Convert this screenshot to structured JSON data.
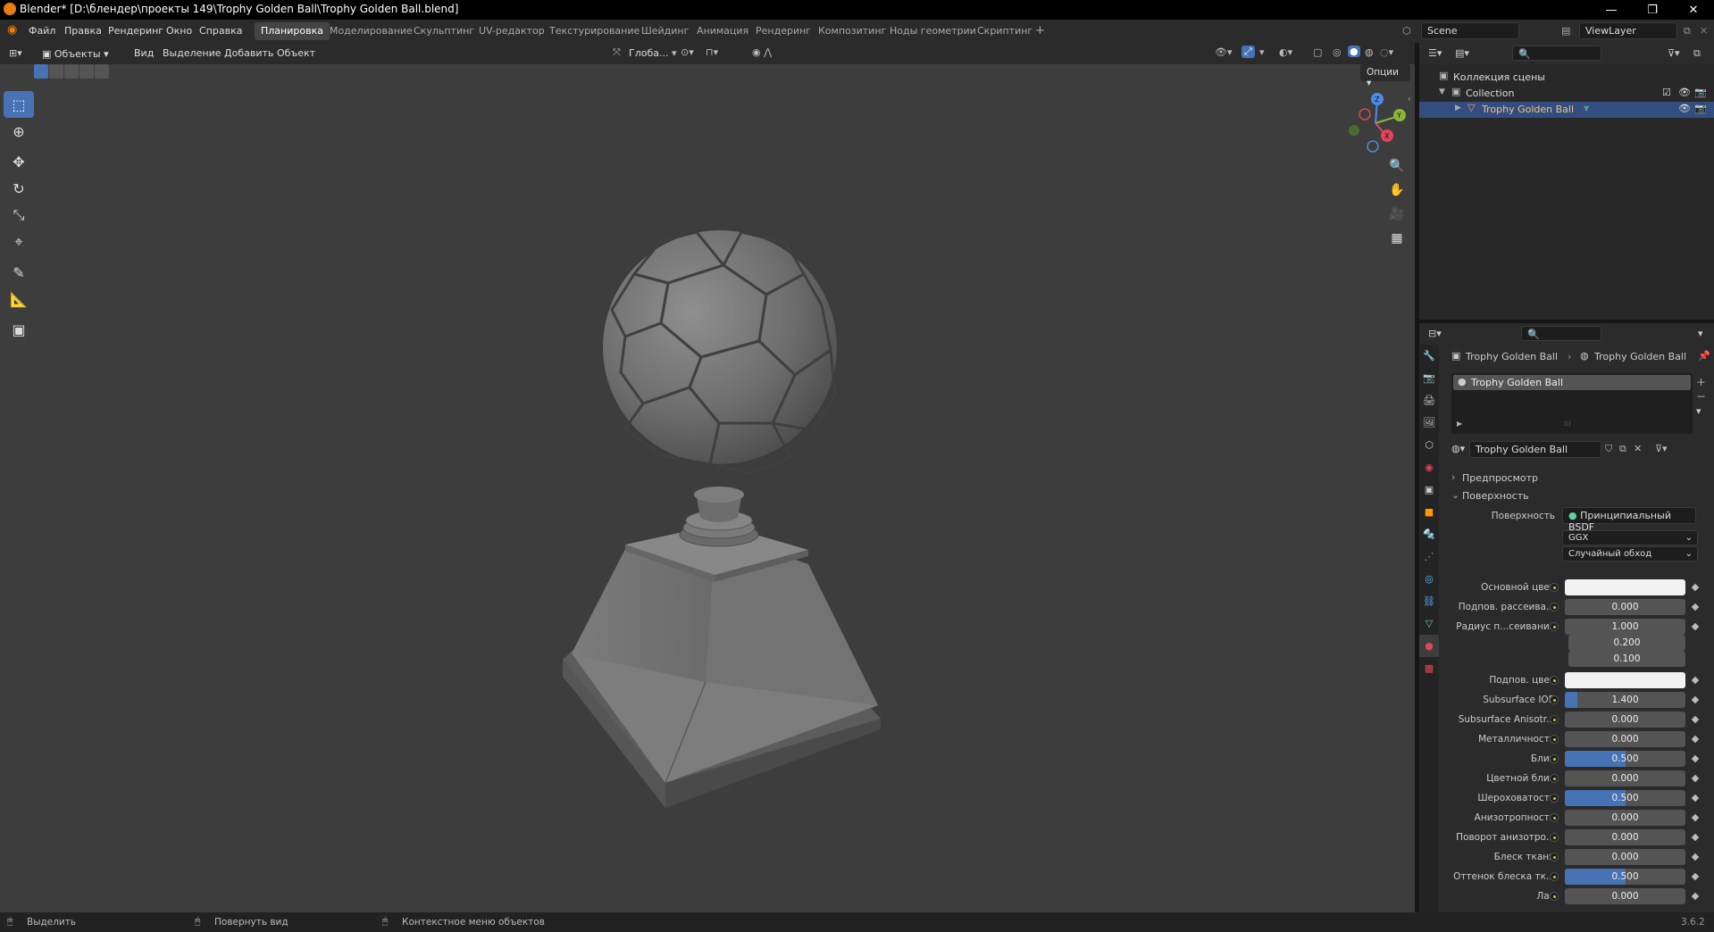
{
  "window": {
    "title": "Blender* [D:\\блендер\\проекты 149\\Trophy Golden Ball\\Trophy Golden Ball.blend]",
    "minimize": "—",
    "maximize": "❐",
    "close": "✕"
  },
  "topbar": {
    "menus": [
      "Файл",
      "Правка",
      "Рендеринг",
      "Окно",
      "Справка"
    ],
    "workspaces": [
      "Планировка",
      "Моделирование",
      "Скульптинг",
      "UV-редактор",
      "Текстурирование",
      "Шейдинг",
      "Анимация",
      "Рендеринг",
      "Композитинг",
      "Ноды геометрии",
      "Скриптинг"
    ],
    "active_workspace": "Планировка",
    "add_workspace": "+",
    "scene": "Scene",
    "view_layer": "ViewLayer"
  },
  "viewport_header": {
    "mode": "Объекты",
    "menus": [
      "Вид",
      "Выделение",
      "Добавить",
      "Объект"
    ],
    "transform_orientation": "Глоба...",
    "options": "Опции"
  },
  "outliner": {
    "search_placeholder": "",
    "rows": [
      {
        "label": "Коллекция сцены"
      },
      {
        "label": "Collection"
      },
      {
        "label": "Trophy Golden Ball"
      }
    ]
  },
  "properties": {
    "breadcrumb": [
      "Trophy Golden Ball",
      "Trophy Golden Ball"
    ],
    "material_slot": "Trophy Golden Ball",
    "material_name": "Trophy Golden Ball",
    "panels": {
      "preview": "Предпросмотр",
      "surface": "Поверхность"
    },
    "surface_label": "Поверхность",
    "surface_shader": "Принципиальный BSDF",
    "distribution": "GGX",
    "subsurface_method": "Случайный обход",
    "rows": [
      {
        "label": "Основной цвет",
        "type": "color",
        "color": "#f2f2f2"
      },
      {
        "label": "Подпов. рассеива...",
        "value": "0.000",
        "fill": 0
      },
      {
        "label": "Радиус п...сеивания",
        "value": "1.000",
        "fill": 0
      },
      {
        "label": "",
        "value": "0.200",
        "fill": 0
      },
      {
        "label": "",
        "value": "0.100",
        "fill": 0
      },
      {
        "label": "Подпов. цвет",
        "type": "color",
        "color": "#f2f2f2"
      },
      {
        "label": "Subsurface IOR",
        "value": "1.400",
        "fill": 0.1
      },
      {
        "label": "Subsurface Anisotr...",
        "value": "0.000",
        "fill": 0
      },
      {
        "label": "Металличность",
        "value": "0.000",
        "fill": 0
      },
      {
        "label": "Блик",
        "value": "0.500",
        "fill": 0.5
      },
      {
        "label": "Цветной блик",
        "value": "0.000",
        "fill": 0
      },
      {
        "label": "Шероховатость",
        "value": "0.500",
        "fill": 0.5
      },
      {
        "label": "Анизотропность",
        "value": "0.000",
        "fill": 0
      },
      {
        "label": "Поворот анизотро...",
        "value": "0.000",
        "fill": 0
      },
      {
        "label": "Блеск ткани",
        "value": "0.000",
        "fill": 0
      },
      {
        "label": "Оттенок блеска тк...",
        "value": "0.500",
        "fill": 0.5
      },
      {
        "label": "Лак",
        "value": "0.000",
        "fill": 0
      }
    ]
  },
  "statusbar": {
    "select": "Выделить",
    "rotate": "Повернуть вид",
    "context": "Контекстное меню объектов",
    "version": "3.6.2"
  },
  "colors": {
    "accent": "#4772b3",
    "viewport_bg": "#3d3d3d",
    "panel_bg": "#2b2b2b"
  }
}
